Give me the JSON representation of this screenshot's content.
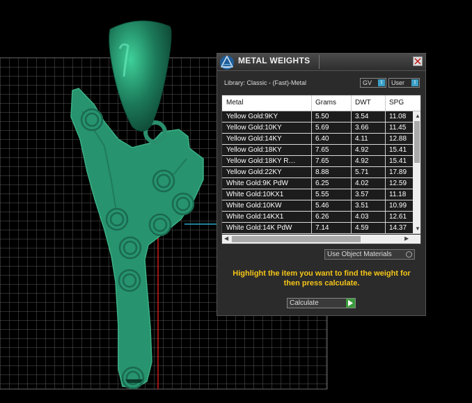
{
  "panel": {
    "title": "METAL WEIGHTS",
    "library": "Library: Classic - (Fast)-Metal",
    "gv_label": "GV",
    "user_label": "User",
    "toggle_glyph": "I",
    "columns": [
      "Metal",
      "Grams",
      "DWT",
      "SPG"
    ],
    "rows": [
      [
        "Yellow Gold:9KY",
        "5.50",
        "3.54",
        "11.08"
      ],
      [
        "Yellow Gold:10KY",
        "5.69",
        "3.66",
        "11.45"
      ],
      [
        "Yellow Gold:14KY",
        "6.40",
        "4.11",
        "12.88"
      ],
      [
        "Yellow Gold:18KY",
        "7.65",
        "4.92",
        "15.41"
      ],
      [
        "Yellow Gold:18KY R…",
        "7.65",
        "4.92",
        "15.41"
      ],
      [
        "Yellow Gold:22KY",
        "8.88",
        "5.71",
        "17.89"
      ],
      [
        "White Gold:9K PdW",
        "6.25",
        "4.02",
        "12.59"
      ],
      [
        "White Gold:10KX1",
        "5.55",
        "3.57",
        "11.18"
      ],
      [
        "White Gold:10KW",
        "5.46",
        "3.51",
        "10.99"
      ],
      [
        "White Gold:14KX1",
        "6.26",
        "4.03",
        "12.61"
      ],
      [
        "White Gold:14K PdW",
        "7.14",
        "4.59",
        "14.37"
      ]
    ],
    "use_object_materials": "Use Object Materials",
    "hint": "Highlight the item you want to find the weight for then press calculate.",
    "calculate": "Calculate"
  },
  "colors": {
    "model": "#27936f",
    "grid": "#5a5a5a",
    "hint": "#f5c518",
    "accent": "#3aa0c8"
  }
}
